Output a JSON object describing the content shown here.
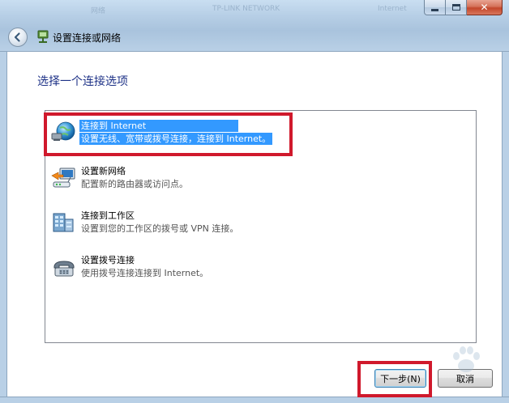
{
  "window": {
    "title": "设置连接或网络",
    "ghost_texts": [
      "网络",
      "TP-LINK NETWORK",
      "Internet"
    ]
  },
  "caption": {
    "minimize_icon": "minimize-icon",
    "maximize_icon": "maximize-icon",
    "close_icon": "close-icon"
  },
  "heading": "选择一个连接选项",
  "options": [
    {
      "title": "连接到 Internet",
      "desc": "设置无线、宽带或拨号连接，连接到 Internet。",
      "icon": "globe-network-icon",
      "selected": true
    },
    {
      "title": "设置新网络",
      "desc": "配置新的路由器或访问点。",
      "icon": "router-icon",
      "selected": false
    },
    {
      "title": "连接到工作区",
      "desc": "设置到您的工作区的拨号或 VPN 连接。",
      "icon": "workplace-building-icon",
      "selected": false
    },
    {
      "title": "设置拨号连接",
      "desc": "使用拨号连接连接到 Internet。",
      "icon": "telephone-icon",
      "selected": false
    }
  ],
  "buttons": {
    "next": "下一步(N)",
    "cancel": "取消"
  },
  "colors": {
    "selection": "#3399ff",
    "heading": "#1e3287",
    "highlight_box": "#d0192c"
  }
}
